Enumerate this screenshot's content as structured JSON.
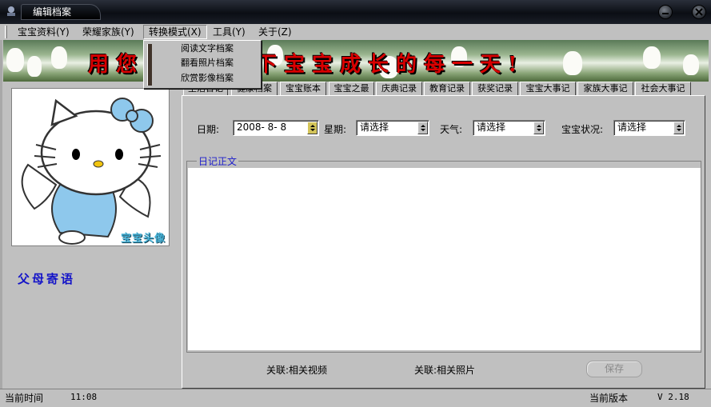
{
  "window": {
    "title": "编辑档案"
  },
  "menubar": {
    "items": [
      {
        "label": "宝宝资料(Y)"
      },
      {
        "label": "荣耀家族(Y)"
      },
      {
        "label": "转换模式(X)"
      },
      {
        "label": "工具(Y)"
      },
      {
        "label": "关于(Z)"
      }
    ]
  },
  "dropdown": {
    "options": [
      {
        "label": "阅读文字档案"
      },
      {
        "label": "翻看照片档案"
      },
      {
        "label": "欣赏影像档案"
      }
    ]
  },
  "banner": {
    "slogan": "用您的爱记录下宝宝成长的每一天!"
  },
  "left_panel": {
    "avatar_label": "宝宝头像",
    "parents_note": "父母寄语"
  },
  "tabs": [
    {
      "label": "生活日记"
    },
    {
      "label": "健康档案"
    },
    {
      "label": "宝宝账本"
    },
    {
      "label": "宝宝之最"
    },
    {
      "label": "庆典记录"
    },
    {
      "label": "教育记录"
    },
    {
      "label": "获奖记录"
    },
    {
      "label": "宝宝大事记"
    },
    {
      "label": "家族大事记"
    },
    {
      "label": "社会大事记"
    }
  ],
  "form": {
    "date_label": "日期:",
    "date_value": "2008- 8- 8",
    "weekday_label": "星期:",
    "weekday_value": "请选择",
    "weather_label": "天气:",
    "weather_value": "请选择",
    "status_label": "宝宝状况:",
    "status_value": "请选择",
    "diary_legend": "日记正文",
    "diary_text": ""
  },
  "actions": {
    "link_video": "关联:相关视频",
    "link_photo": "关联:相关照片",
    "save": "保存"
  },
  "statusbar": {
    "time_label": "当前时间",
    "time_value": "11:08",
    "version_label": "当前版本",
    "version_value": "V 2.18"
  },
  "colors": {
    "slogan": "#d80000",
    "accent_blue": "#1c1ccb",
    "avatar_label": "#4ab4d8"
  }
}
